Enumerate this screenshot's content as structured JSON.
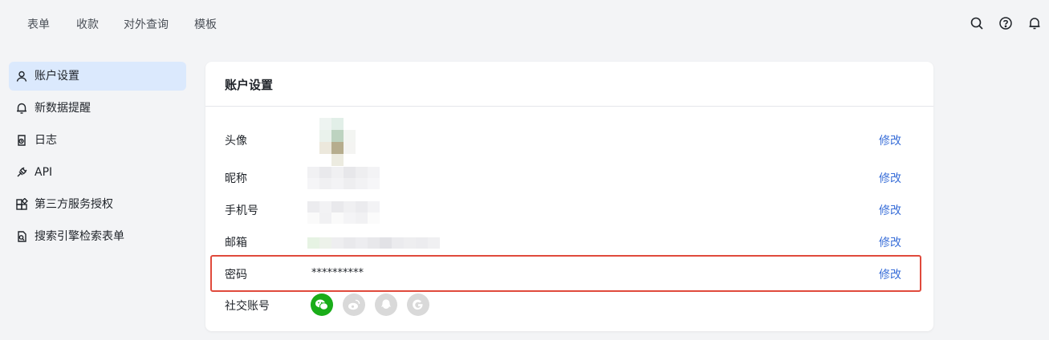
{
  "topnav": {
    "tabs": [
      {
        "label": "表单"
      },
      {
        "label": "收款"
      },
      {
        "label": "对外查询"
      },
      {
        "label": "模板"
      }
    ],
    "icons": [
      "search-icon",
      "help-icon",
      "bell-icon"
    ]
  },
  "sidebar": {
    "items": [
      {
        "label": "账户设置",
        "icon": "user-icon",
        "active": true
      },
      {
        "label": "新数据提醒",
        "icon": "bell-icon"
      },
      {
        "label": "日志",
        "icon": "log-icon"
      },
      {
        "label": "API",
        "icon": "plug-icon"
      },
      {
        "label": "第三方服务授权",
        "icon": "apps-icon"
      },
      {
        "label": "搜索引擎检索表单",
        "icon": "search-file-icon"
      }
    ]
  },
  "account": {
    "title": "账户设置",
    "avatar_label": "头像",
    "nickname_label": "昵称",
    "phone_label": "手机号",
    "email_label": "邮箱",
    "password_label": "密码",
    "password_value": "**********",
    "social_label": "社交账号",
    "edit_label": "修改",
    "social_accounts": [
      {
        "name": "wechat-icon",
        "bound": true,
        "color": "#1aad19"
      },
      {
        "name": "weibo-icon",
        "bound": false,
        "color": "#d9d9d9"
      },
      {
        "name": "qq-icon",
        "bound": false,
        "color": "#d9d9d9"
      },
      {
        "name": "google-icon",
        "bound": false,
        "color": "#d9d9d9"
      }
    ]
  },
  "colors": {
    "accent": "#3a6fd8",
    "highlight": "#e04a3c",
    "active_bg": "#dbe9fd"
  }
}
